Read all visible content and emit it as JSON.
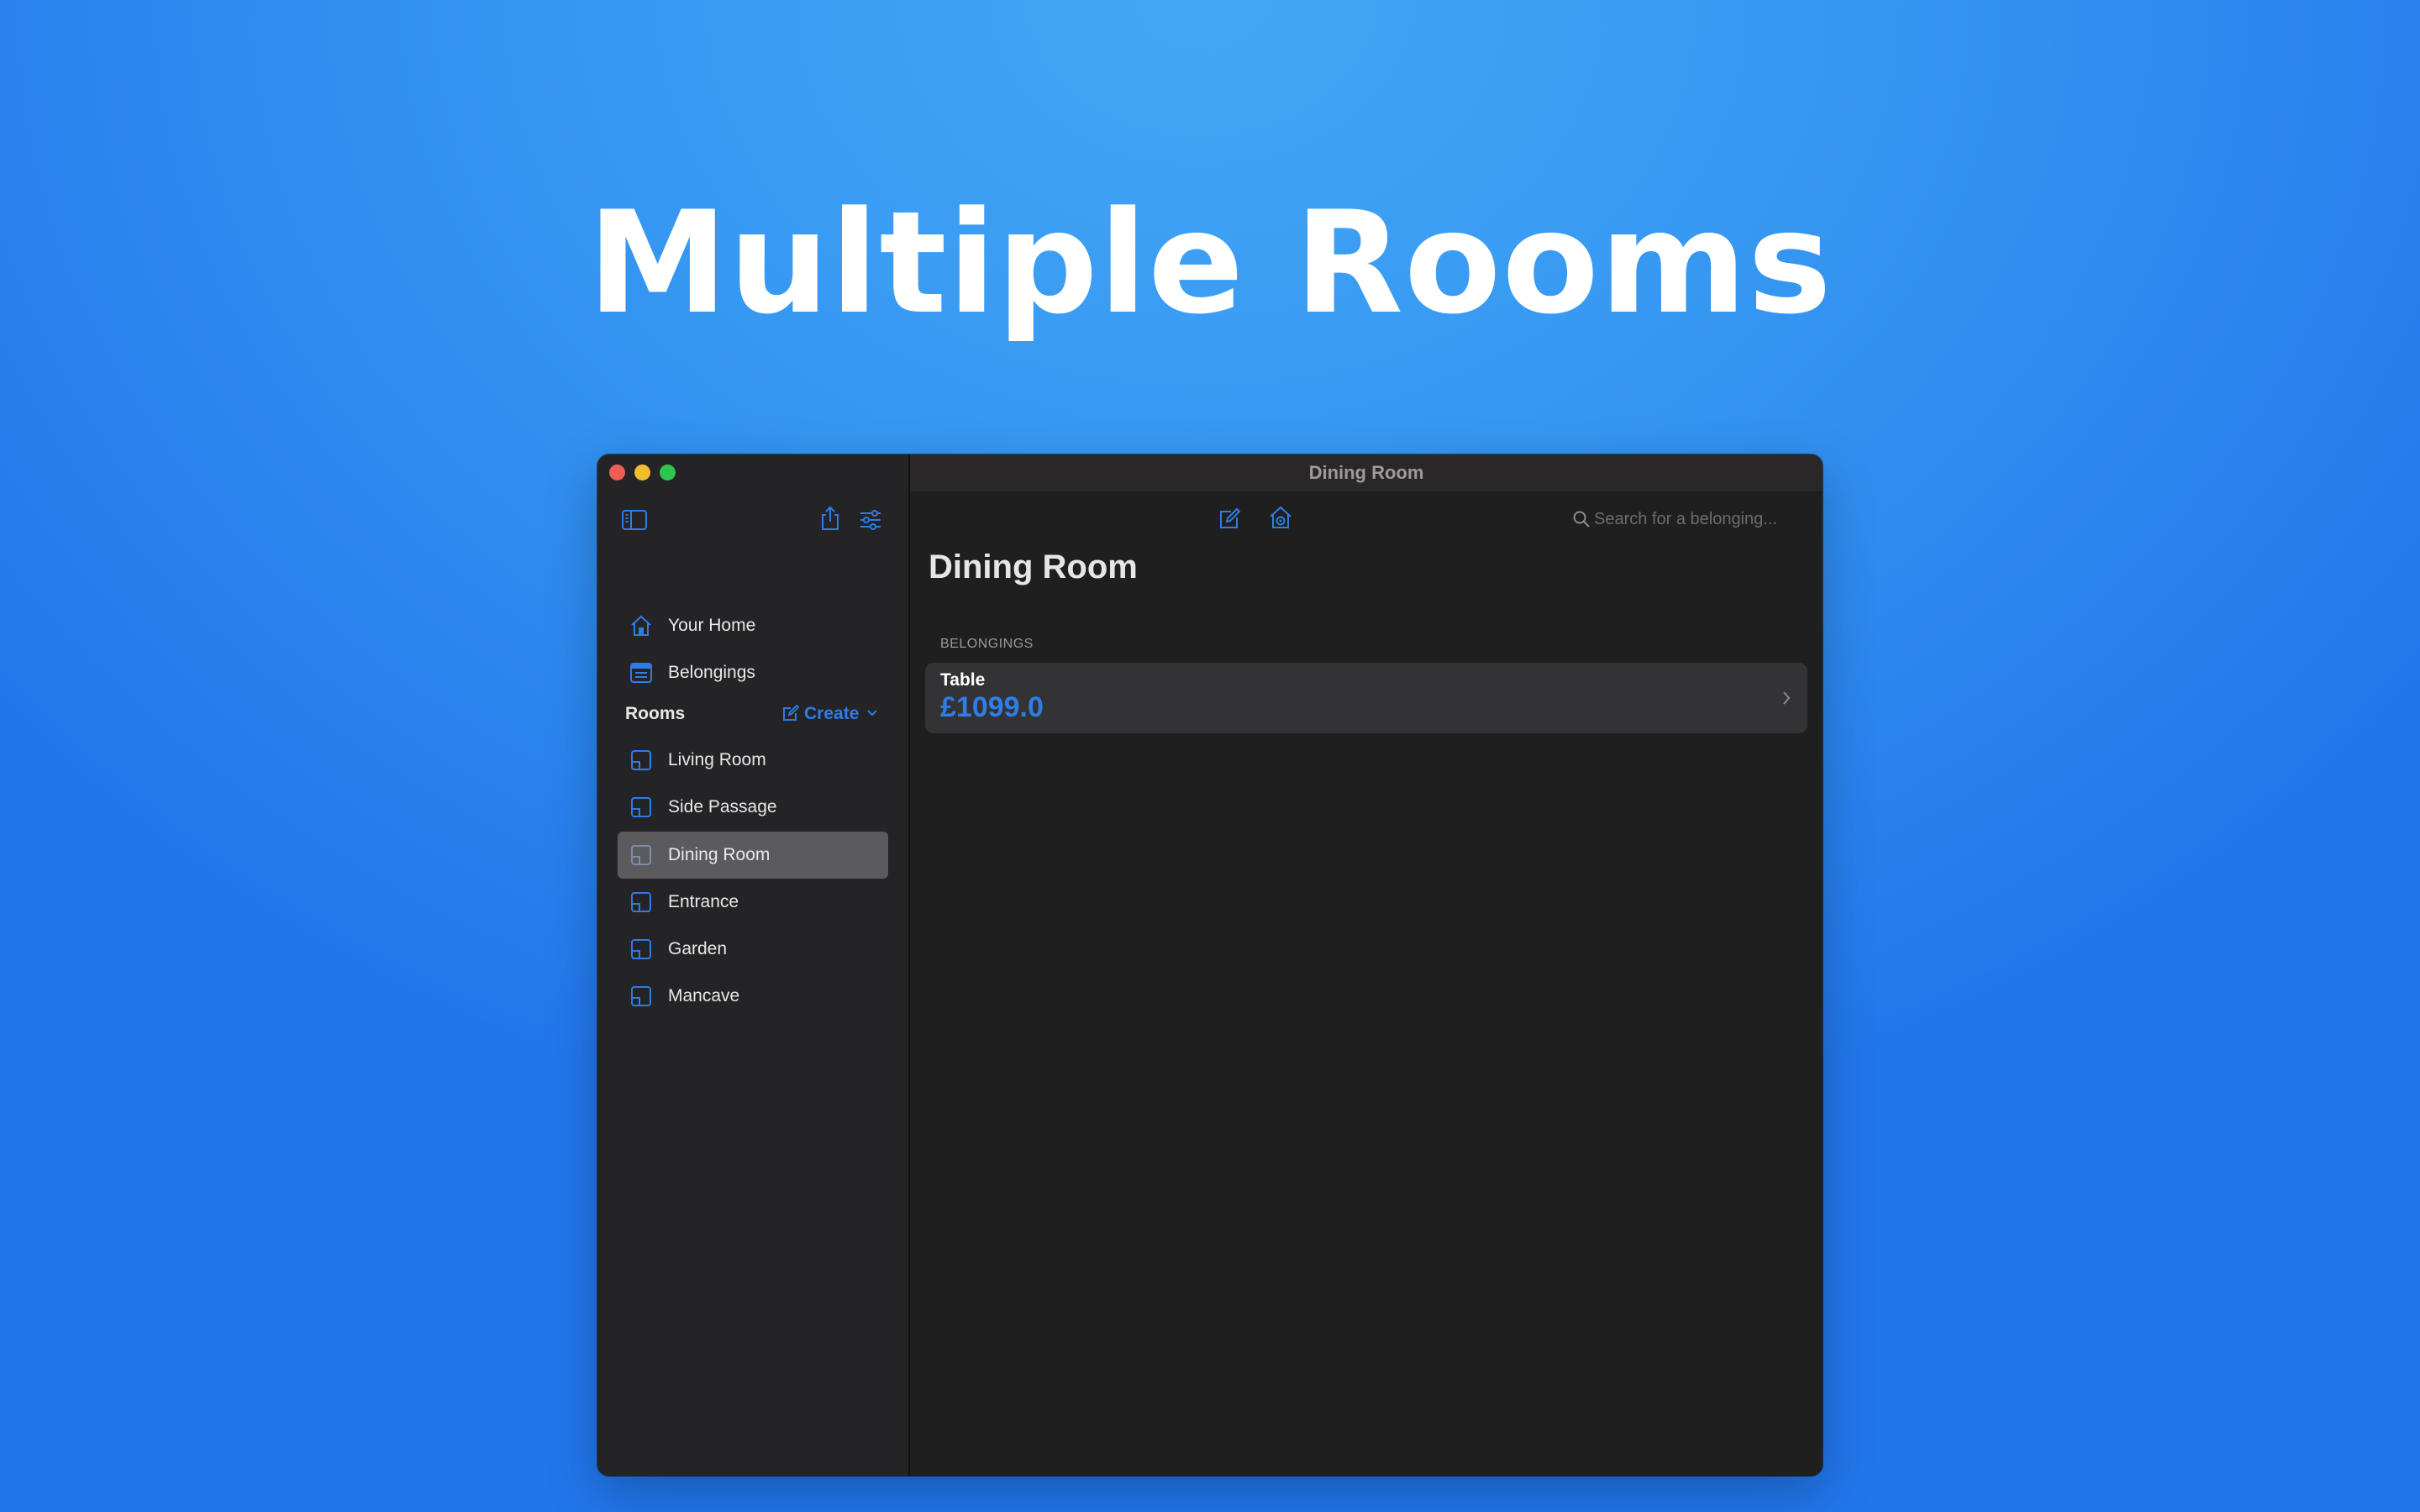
{
  "headline": "Multiple Rooms",
  "window": {
    "title": "Dining Room"
  },
  "sidebar": {
    "nav": [
      {
        "label": "Your Home",
        "icon": "house-icon"
      },
      {
        "label": "Belongings",
        "icon": "list-icon"
      }
    ],
    "rooms_header": "Rooms",
    "create_label": "Create",
    "rooms": [
      {
        "label": "Living Room",
        "icon": "room-icon",
        "selected": false
      },
      {
        "label": "Side Passage",
        "icon": "room-icon",
        "selected": false
      },
      {
        "label": "Dining Room",
        "icon": "room-icon",
        "selected": true
      },
      {
        "label": "Entrance",
        "icon": "room-icon",
        "selected": false
      },
      {
        "label": "Garden",
        "icon": "room-icon",
        "selected": false
      },
      {
        "label": "Mancave",
        "icon": "room-icon",
        "selected": false
      }
    ]
  },
  "toolbar": {
    "search_placeholder": "Search for a belonging..."
  },
  "main": {
    "title": "Dining Room",
    "section_label": "BELONGINGS",
    "items": [
      {
        "name": "Table",
        "price": "£1099.0"
      }
    ]
  },
  "colors": {
    "accent": "#2e7de6",
    "background_top": "#43a7f5",
    "background_bottom": "#2276ec",
    "window_bg": "#1f1f1f",
    "sidebar_bg": "#242325",
    "selected_bg": "#5b5a5d"
  }
}
